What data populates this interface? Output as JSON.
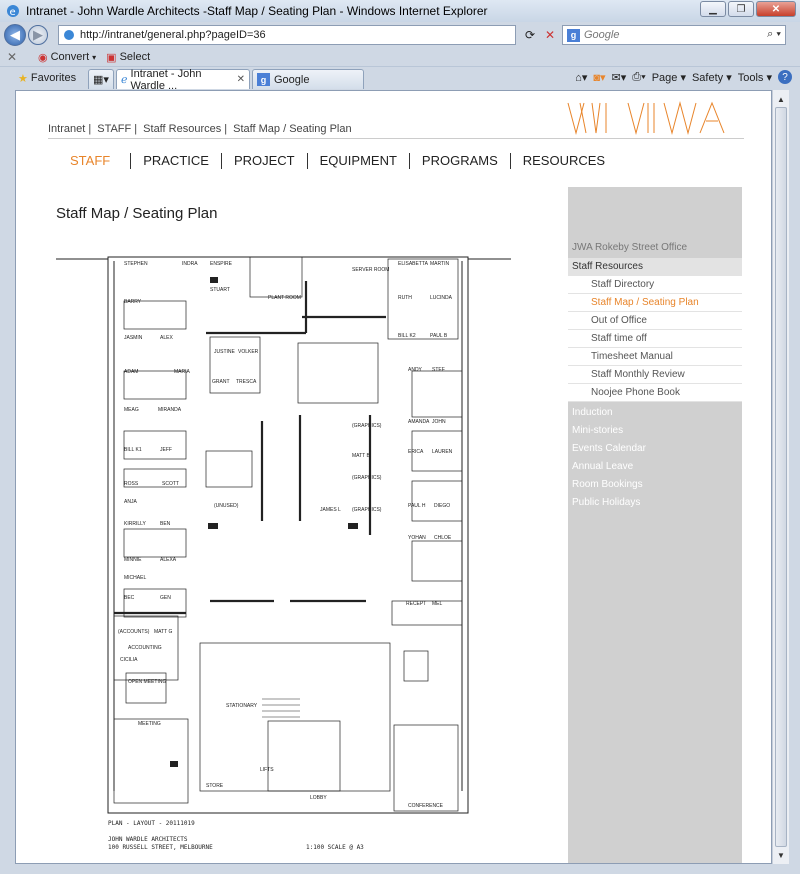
{
  "window": {
    "title": "Intranet - John Wardle Architects -Staff Map / Seating Plan - Windows Internet Explorer"
  },
  "address_bar": {
    "url": "http://intranet/general.php?pageID=36"
  },
  "search": {
    "placeholder": "Google"
  },
  "command_bar": {
    "convert": "Convert",
    "select": "Select"
  },
  "favorites_bar": {
    "favorites": "Favorites"
  },
  "tabs": [
    {
      "label": "Intranet - John Wardle ..."
    },
    {
      "label": "Google"
    }
  ],
  "toolbar_right": {
    "page": "Page",
    "safety": "Safety",
    "tools": "Tools",
    "help": "?"
  },
  "breadcrumb": [
    "Intranet",
    "STAFF",
    "Staff Resources",
    "Staff Map / Seating Plan"
  ],
  "main_nav": [
    "STAFF",
    "PRACTICE",
    "PROJECT",
    "EQUIPMENT",
    "PROGRAMS",
    "RESOURCES"
  ],
  "page_title": "Staff Map / Seating Plan",
  "sidebar": {
    "items": [
      {
        "label": "JWA Rokeby Street Office",
        "type": "muted"
      },
      {
        "label": "Staff Resources",
        "type": "group"
      },
      {
        "label": "Staff Directory",
        "type": "sub"
      },
      {
        "label": "Staff Map / Seating Plan",
        "type": "current"
      },
      {
        "label": "Out of Office",
        "type": "sub"
      },
      {
        "label": "Staff time off",
        "type": "sub"
      },
      {
        "label": "Timesheet Manual",
        "type": "sub"
      },
      {
        "label": "Staff Monthly Review",
        "type": "sub"
      },
      {
        "label": "Noojee Phone Book",
        "type": "sub"
      },
      {
        "label": "Induction",
        "type": "top"
      },
      {
        "label": "Mini-stories",
        "type": "top"
      },
      {
        "label": "Events Calendar",
        "type": "top"
      },
      {
        "label": "Annual Leave",
        "type": "top"
      },
      {
        "label": "Room Bookings",
        "type": "top"
      },
      {
        "label": "Public Holidays",
        "type": "top"
      }
    ]
  },
  "floorplan": {
    "caption_plan": "PLAN - LAYOUT - 20111019",
    "caption_firm": "JOHN WARDLE ARCHITECTS",
    "caption_address": "100 RUSSELL STREET, MELBOURNE",
    "caption_scale": "1:100 SCALE @ A3",
    "names": [
      "STEPHEN",
      "INDRA",
      "ENSPIRE",
      "BARRY",
      "STUART",
      "JASMIN",
      "ALEX",
      "JUSTINE",
      "VOLKER",
      "ADAM",
      "MARIA",
      "GRANT",
      "TRESCA",
      "MEAG",
      "MIRANDA",
      "BILL K1",
      "JEFF",
      "ROSS",
      "SCOTT",
      "ANJA",
      "KIRRILLY",
      "BEN",
      "MINNIE",
      "ALEXA",
      "MICHAEL",
      "BEC",
      "GEN",
      "(ACCOUNTS)",
      "MATT G",
      "ACCOUNTING",
      "CICILIA",
      "OPEN MEETING",
      "MEETING",
      "STORE",
      "STATIONARY",
      "LOBBY",
      "LIFTS",
      "PLANT ROOM",
      "SERVER ROOM",
      "ELISABETTA",
      "MARTIN",
      "RUTH",
      "LUCINDA",
      "BILL K2",
      "PAUL B",
      "ANDY",
      "STEF",
      "AMANDA",
      "JOHN",
      "ERICA",
      "LAUREN",
      "PAUL H",
      "DIEGO",
      "YOHAN",
      "CHLOE",
      "RECEPT",
      "MEL",
      "CONFERENCE",
      "(GRAPHICS)",
      "MATT B",
      "(GRAPHICS)",
      "JAMES L",
      "(GRAPHICS)",
      "(UNUSED)"
    ]
  }
}
